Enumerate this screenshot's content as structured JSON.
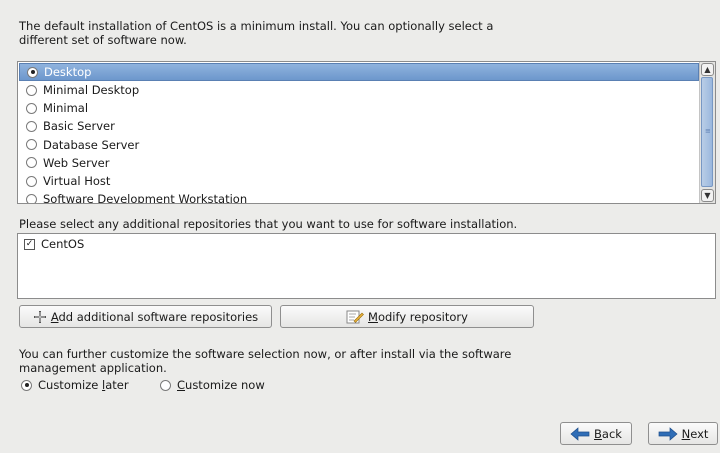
{
  "intro_text": "The default installation of CentOS is a minimum install. You can optionally select a different set of software now.",
  "software_sets": [
    {
      "label": "Desktop",
      "selected": true
    },
    {
      "label": "Minimal Desktop",
      "selected": false
    },
    {
      "label": "Minimal",
      "selected": false
    },
    {
      "label": "Basic Server",
      "selected": false
    },
    {
      "label": "Database Server",
      "selected": false
    },
    {
      "label": "Web Server",
      "selected": false
    },
    {
      "label": "Virtual Host",
      "selected": false
    },
    {
      "label": "Software Development Workstation",
      "selected": false
    }
  ],
  "repo_prompt": "Please select any additional repositories that you want to use for software installation.",
  "repositories": [
    {
      "label": "CentOS",
      "checked": true
    }
  ],
  "buttons": {
    "add_repo": {
      "mnemonic": "A",
      "rest": "dd additional software repositories"
    },
    "modify_repo": {
      "mnemonic": "M",
      "rest": "odify repository"
    },
    "back": {
      "mnemonic": "B",
      "rest": "ack"
    },
    "next": {
      "mnemonic": "N",
      "rest": "ext"
    }
  },
  "customize_text": "You can further customize the software selection now, or after install via the software management application.",
  "customize_options": {
    "later": {
      "pre": "Customize ",
      "mnemonic": "l",
      "rest": "ater",
      "selected": true
    },
    "now": {
      "pre": "",
      "mnemonic": "C",
      "rest": "ustomize now",
      "selected": false
    }
  },
  "colors": {
    "selection": "#7aa0d3",
    "background": "#ececea",
    "arrow": "#2f6db6"
  }
}
